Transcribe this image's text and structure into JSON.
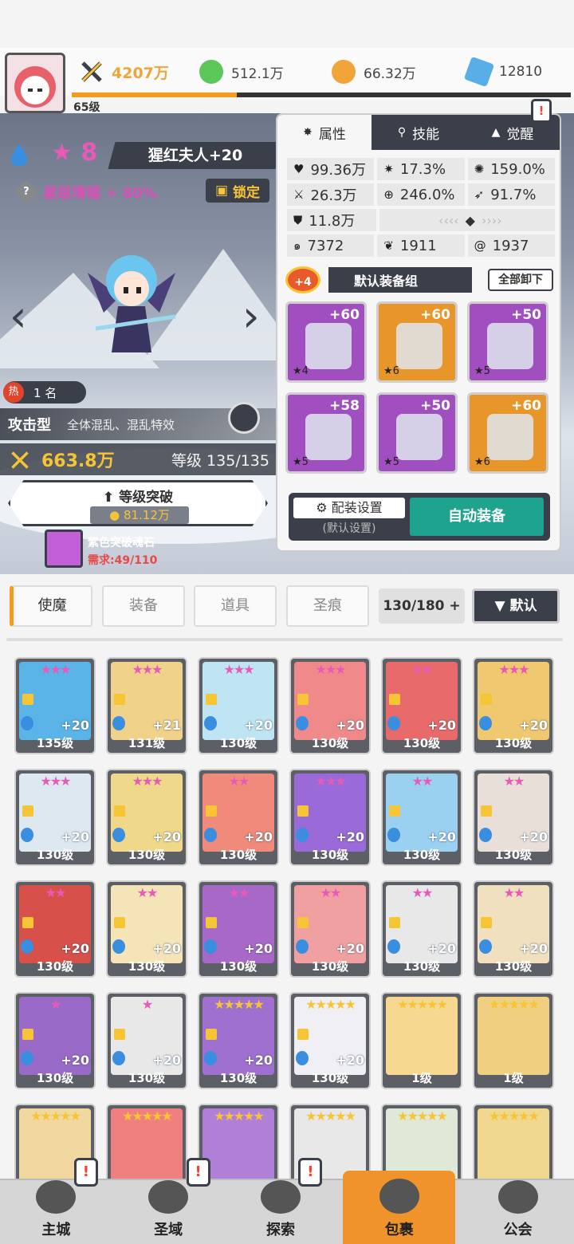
{
  "top": {
    "level": "65级",
    "power": "4207万",
    "resources": [
      {
        "name": "green-gem-icon",
        "value": "512.1万",
        "color": "#5cc85a"
      },
      {
        "name": "gold-coin-icon",
        "value": "66.32万",
        "color": "#f0a43a"
      },
      {
        "name": "blue-diamond-icon",
        "value": "12810",
        "color": "#5aaee8"
      }
    ],
    "xp_fraction": 0.33
  },
  "hero": {
    "stars": "8",
    "name": "猩红夫人+20",
    "boost": "星级增幅 + 80%",
    "lock": "锁定",
    "rank": "1 名",
    "hot": "热",
    "type": "攻击型",
    "traits": "全体混乱、混乱特效",
    "power": "663.8万",
    "level": "等级 135/135",
    "break_title": "等级突破",
    "break_cost": "81.12万",
    "stone_name": "紫色突破魂石",
    "stone_req": "需求:49/110"
  },
  "panel": {
    "tabs": [
      "属性",
      "技能",
      "觉醒"
    ],
    "stats": [
      [
        "99.36万",
        "17.3%",
        "159.0%"
      ],
      [
        "26.3万",
        "246.0%",
        "91.7%"
      ],
      [
        "11.8万"
      ],
      [
        "7372",
        "1911",
        "1937"
      ]
    ],
    "set_badge": "+4",
    "set_name": "默认装备组",
    "unequip": "全部卸下",
    "equips": [
      {
        "plus": "+60",
        "stars": "★4",
        "color": "p"
      },
      {
        "plus": "+60",
        "stars": "★6",
        "color": "o"
      },
      {
        "plus": "+50",
        "stars": "★5",
        "color": "p"
      },
      {
        "plus": "+58",
        "stars": "★5",
        "color": "p"
      },
      {
        "plus": "+50",
        "stars": "★5",
        "color": "p"
      },
      {
        "plus": "+60",
        "stars": "★6",
        "color": "o"
      }
    ],
    "config": "配装设置",
    "config_sub": "(默认设置)",
    "auto": "自动装备"
  },
  "filters": {
    "tabs": [
      "使魔",
      "装备",
      "道具",
      "圣痕"
    ],
    "count": "130/180 +",
    "sort": "▼ 默认"
  },
  "heroes": [
    {
      "stars": "★★★",
      "sc": "#e85ab8",
      "plus": "+20",
      "lv": "135级",
      "face": "#5ab4e8"
    },
    {
      "stars": "★★★",
      "sc": "#e85ab8",
      "plus": "+21",
      "lv": "131级",
      "face": "#f0d28a"
    },
    {
      "stars": "★★★",
      "sc": "#e85ab8",
      "plus": "+20",
      "lv": "130级",
      "face": "#bfe4f4"
    },
    {
      "stars": "★★★",
      "sc": "#e85ab8",
      "plus": "+20",
      "lv": "130级",
      "face": "#f08a8a"
    },
    {
      "stars": "★★",
      "sc": "#e85ab8",
      "plus": "+20",
      "lv": "130级",
      "face": "#e86a6a"
    },
    {
      "stars": "★★★",
      "sc": "#e85ab8",
      "plus": "+20",
      "lv": "130级",
      "face": "#f0c870"
    },
    {
      "stars": "★★★",
      "sc": "#e85ab8",
      "plus": "+20",
      "lv": "130级",
      "face": "#dde8f0"
    },
    {
      "stars": "★★★",
      "sc": "#e85ab8",
      "plus": "+20",
      "lv": "130级",
      "face": "#f0d88a"
    },
    {
      "stars": "★★",
      "sc": "#e85ab8",
      "plus": "+20",
      "lv": "130级",
      "face": "#f08a7a"
    },
    {
      "stars": "★★★",
      "sc": "#e85ab8",
      "plus": "+20",
      "lv": "130级",
      "face": "#9a6ad8"
    },
    {
      "stars": "★★",
      "sc": "#e85ab8",
      "plus": "+20",
      "lv": "130级",
      "face": "#9ad0f0"
    },
    {
      "stars": "★★",
      "sc": "#e85ab8",
      "plus": "+20",
      "lv": "130级",
      "face": "#e8e0d8"
    },
    {
      "stars": "★★",
      "sc": "#e85ab8",
      "plus": "+20",
      "lv": "130级",
      "face": "#d8504a"
    },
    {
      "stars": "★★",
      "sc": "#e85ab8",
      "plus": "+20",
      "lv": "130级",
      "face": "#f4e4b8"
    },
    {
      "stars": "★★",
      "sc": "#e85ab8",
      "plus": "+20",
      "lv": "130级",
      "face": "#a868c8"
    },
    {
      "stars": "★★",
      "sc": "#e85ab8",
      "plus": "+20",
      "lv": "130级",
      "face": "#f0a0a0"
    },
    {
      "stars": "★★",
      "sc": "#e85ab8",
      "plus": "+20",
      "lv": "130级",
      "face": "#e8e8e8"
    },
    {
      "stars": "★★",
      "sc": "#e85ab8",
      "plus": "+20",
      "lv": "130级",
      "face": "#f0e0c0"
    },
    {
      "stars": "★",
      "sc": "#e85ab8",
      "plus": "+20",
      "lv": "130级",
      "face": "#9a6ac8"
    },
    {
      "stars": "★",
      "sc": "#e85ab8",
      "plus": "+20",
      "lv": "130级",
      "face": "#e8e8e8"
    },
    {
      "stars": "★★★★★",
      "sc": "#f5c535",
      "plus": "+20",
      "lv": "130级",
      "face": "#a070d0"
    },
    {
      "stars": "★★★★★",
      "sc": "#f5c535",
      "plus": "+20",
      "lv": "130级",
      "face": "#f0f0f4"
    },
    {
      "stars": "★★★★★",
      "sc": "#f5c535",
      "plus": "",
      "lv": "1级",
      "face": "#f6d890"
    },
    {
      "stars": "★★★★★",
      "sc": "#f5c535",
      "plus": "",
      "lv": "1级",
      "face": "#f0d080"
    },
    {
      "stars": "★★★★★",
      "sc": "#f5c535",
      "plus": "",
      "lv": "",
      "face": "#f0d8a0"
    },
    {
      "stars": "★★★★★",
      "sc": "#f5c535",
      "plus": "",
      "lv": "",
      "face": "#f08080"
    },
    {
      "stars": "★★★★★",
      "sc": "#f5c535",
      "plus": "",
      "lv": "",
      "face": "#b080d8"
    },
    {
      "stars": "★★★★★",
      "sc": "#f5c535",
      "plus": "",
      "lv": "",
      "face": "#e8e8e8"
    },
    {
      "stars": "★★★★★",
      "sc": "#f5c535",
      "plus": "",
      "lv": "",
      "face": "#e0e8d8"
    },
    {
      "stars": "★★★★★",
      "sc": "#f5c535",
      "plus": "",
      "lv": "",
      "face": "#f0d890"
    }
  ],
  "nav": [
    {
      "label": "主城",
      "badge": "!"
    },
    {
      "label": "圣域",
      "badge": "!"
    },
    {
      "label": "探索",
      "badge": "!"
    },
    {
      "label": "包裹",
      "badge": ""
    },
    {
      "label": "公会",
      "badge": ""
    }
  ]
}
